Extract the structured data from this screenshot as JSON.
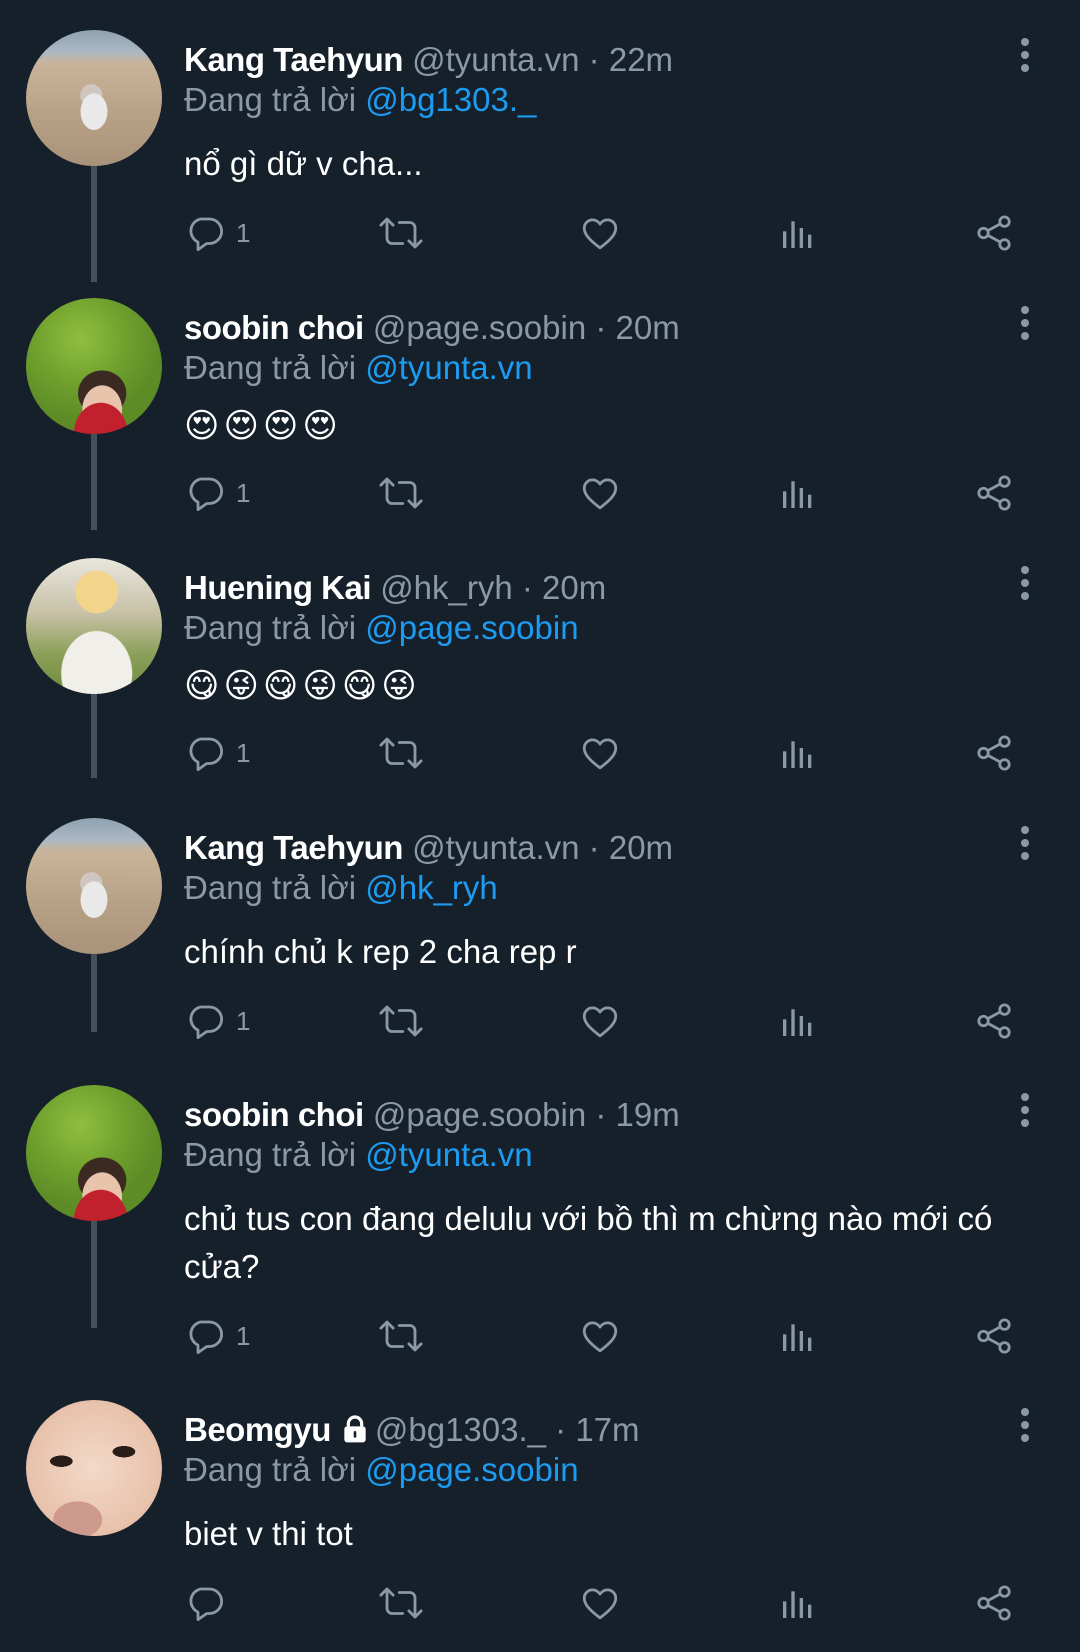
{
  "colors": {
    "background": "#15202b",
    "muted": "#8b98a5",
    "link": "#1d9bf0",
    "thread_line": "#434f5b"
  },
  "replying_prefix": "Đang trả lời",
  "tweets": [
    {
      "name": "Kang Taehyun",
      "handle": "@tyunta.vn · 22m",
      "replying_to": "@bg1303._",
      "text": "nổ gì dữ v cha...",
      "reply_count": "1",
      "avatar": "beach-avatar"
    },
    {
      "name": "soobin choi",
      "handle": "@page.soobin · 20m",
      "replying_to": "@tyunta.vn",
      "emojis": [
        "😍",
        "😍",
        "😍",
        "😍"
      ],
      "reply_count": "1",
      "avatar": "grass-avatar"
    },
    {
      "name": "Huening Kai",
      "handle": "@hk_ryh · 20m",
      "replying_to": "@page.soobin",
      "emojis": [
        "😋",
        "😜",
        "😋",
        "😜",
        "😋",
        "😜"
      ],
      "reply_count": "1",
      "avatar": "kai-avatar"
    },
    {
      "name": "Kang Taehyun",
      "handle": "@tyunta.vn · 20m",
      "replying_to": "@hk_ryh",
      "text": "chính chủ k rep 2 cha rep r",
      "reply_count": "1",
      "avatar": "beach-avatar"
    },
    {
      "name": "soobin choi",
      "handle": "@page.soobin · 19m",
      "replying_to": "@tyunta.vn",
      "text": "chủ tus con đang delulu với bồ thì m chừng nào mới có cửa?",
      "reply_count": "1",
      "avatar": "grass-avatar"
    },
    {
      "name": "Beomgyu",
      "handle": "@bg1303._ · 17m",
      "replying_to": "@page.soobin",
      "text": "biet v thi tot",
      "reply_count": "",
      "avatar": "face-avatar",
      "protected": true
    }
  ],
  "icons": [
    "reply-icon",
    "retweet-icon",
    "like-icon",
    "views-icon",
    "share-icon",
    "more-options-icon",
    "lock-icon"
  ]
}
